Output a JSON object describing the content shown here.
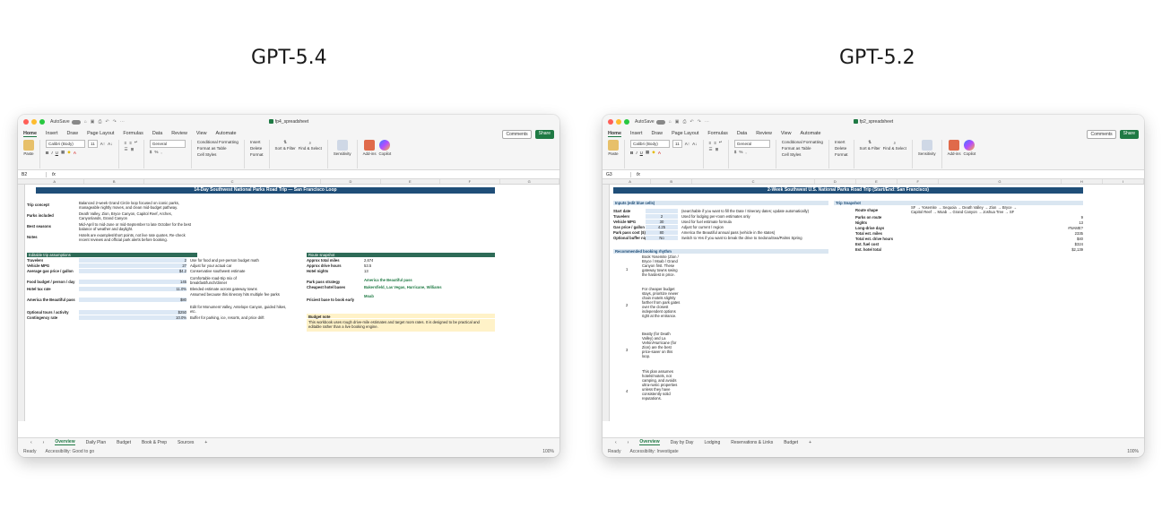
{
  "headings": {
    "left": "GPT-5.4",
    "right": "GPT-5.2"
  },
  "common": {
    "autosave": "AutoSave",
    "menus": [
      "Home",
      "Insert",
      "Draw",
      "Page Layout",
      "Formulas",
      "Data",
      "Review",
      "View",
      "Automate"
    ],
    "comments": "Comments",
    "share": "Share",
    "paste": "Paste",
    "font": "Calibri (Body)",
    "font_size": "11",
    "number_format": "General",
    "cond_format": "Conditional Formatting",
    "format_table": "Format as Table",
    "cell_styles": "Cell Styles",
    "insert": "Insert",
    "delete": "Delete",
    "format": "Format",
    "sort_filter": "Sort & Filter",
    "find_select": "Find & Select",
    "sensitivity": "Sensitivity",
    "addins": "Add-ins",
    "copilot": "Copilot",
    "ready": "Ready",
    "zoom": "100%"
  },
  "left": {
    "filename": "fp4_spreadsheet",
    "cellref": "B2",
    "title": "14-Day Southwest National Parks Road Trip — San Francisco Loop",
    "overview": [
      {
        "label": "Trip concept",
        "value": "Balanced 2-week Grand Circle loop focused on iconic parks, manageable nightly moves, and clean mid-budget pathway."
      },
      {
        "label": "Parks included",
        "value": "Death Valley, Zion, Bryce Canyon, Capitol Reef, Arches, Canyonlands, Grand Canyon"
      },
      {
        "label": "Best seasons",
        "value": "Mid-April to mid-June or mid-September to late October for the best balance of weather and daylight."
      },
      {
        "label": "Notes",
        "value": "Hotels are examples/short points, not live rate quotes. Re-check recent reviews and official park alerts before booking."
      }
    ],
    "assumptions_title": "Editable trip assumptions",
    "assumptions": [
      {
        "label": "Travelers",
        "value": "2",
        "note": "Use for food and per-person budget math"
      },
      {
        "label": "Vehicle MPG",
        "value": "27",
        "note": "Adjust for your actual car"
      },
      {
        "label": "Average gas price / gallon",
        "value": "$4.2",
        "note": "Conservative southwest estimate"
      },
      {
        "label": "Food budget / person / day",
        "value": "145",
        "note": "Comfortable road-trip mix of breakfast/lunch/dinner"
      },
      {
        "label": "Hotel tax rate",
        "value": "11.0%",
        "note": "Blended estimate across gateway towns"
      },
      {
        "label": "America the Beautiful pass",
        "value": "$80",
        "note": "Assumed because this itinerary hits multiple fee parks"
      },
      {
        "label": "Optional tours / activity",
        "value": "$250",
        "note": "Edit for Monument Valley, Antelope Canyon, guided hikes, etc."
      },
      {
        "label": "Contingency rate",
        "value": "10.0%",
        "note": "Buffer for parking, ice, resorts, and price drift"
      }
    ],
    "snapshot_title": "Route snapshot",
    "snapshot": [
      {
        "label": "Approx total miles",
        "value": "2,674"
      },
      {
        "label": "Approx drive hours",
        "value": "53.5"
      },
      {
        "label": "Hotel nights",
        "value": "13"
      },
      {
        "label": "Park pass strategy",
        "value": "America the Beautiful pass"
      },
      {
        "label": "Cheapest hotel bases",
        "value": "Bakersfield, Las Vegas, Hurricane, Williams"
      },
      {
        "label": "Priciest base to book early",
        "value": "Moab"
      }
    ],
    "budget_note_title": "Budget note",
    "budget_note": "This workbook uses rough drive-mile estimates and target room rates. It is designed to be practical and editable rather than a live booking engine.",
    "tabs": [
      "Overview",
      "Daily Plan",
      "Budget",
      "Book & Prep",
      "Sources"
    ],
    "accessibility": "Accessibility: Good to go"
  },
  "right": {
    "filename": "fp2_spreadsheet",
    "cellref": "G3",
    "title": "2-Week Southwest U.S. National Parks Road Trip (Start/End: San Francisco)",
    "inputs_title": "Inputs (edit blue cells)",
    "inputs": [
      {
        "label": "Start date",
        "value": "",
        "note": "(searchable if you want to fill the Date / Itinerary dates; update automatically)"
      },
      {
        "label": "Travelers",
        "value": "2",
        "note": "Used for lodging per-room estimates only"
      },
      {
        "label": "Vehicle MPG",
        "value": "30",
        "note": "Used for fuel estimate formula"
      },
      {
        "label": "Gas price / gallon",
        "value": "4.25",
        "note": "Adjust for current / region"
      },
      {
        "label": "Park pass cost ($)",
        "value": "80",
        "note": "America the Beautiful annual pass (vehicle in the states)"
      },
      {
        "label": "Optional buffer night (Y/N)",
        "value": "No",
        "note": "Switch to Yes if you want to break the drive to Sedona/Sea/Palms Spring"
      }
    ],
    "snapshot_title": "Trip Snapshot",
    "snapshot": [
      {
        "label": "Route shape",
        "value": "SF → Yosemite → Sequoia → Death Valley → Zion → Bryce → Capitol Reef → Moab → Grand Canyon → Joshua Tree → SF"
      },
      {
        "label": "Parks on route",
        "value": "9"
      },
      {
        "label": "Nights",
        "value": "13"
      },
      {
        "label": "Long-drive days",
        "value": "#NAME?"
      },
      {
        "label": "Total est. miles",
        "value": "2335"
      },
      {
        "label": "Total est. drive hours",
        "value": "$40"
      },
      {
        "label": "Est. fuel cost",
        "value": "$324"
      },
      {
        "label": "Est. hotel total",
        "value": "$2,139"
      }
    ],
    "booking_title": "Recommended booking rhythm",
    "booking": [
      {
        "num": "1",
        "text": "Book Yosemite (Zion / Bryce / Moab / Grand Canyon first. These gateway towns swing the hardest in price."
      },
      {
        "num": "2",
        "text": "For cheaper budget stays, prioritize newer chain motels slightly farther from park gates over the closest independent options right at the entrance."
      },
      {
        "num": "3",
        "text": "Beatty (for Death Valley) and La Verkin/Hurricane (for Zion) are the best price-saver on this loop."
      },
      {
        "num": "4",
        "text": "This plan assumes hotels/motels, not camping, and avoids ultra-rustic properties unless they have consistently solid reputations."
      }
    ],
    "tabs": [
      "Overview",
      "Day by Day",
      "Lodging",
      "Reservations & Links",
      "Budget"
    ],
    "accessibility": "Accessibility: Investigate"
  }
}
